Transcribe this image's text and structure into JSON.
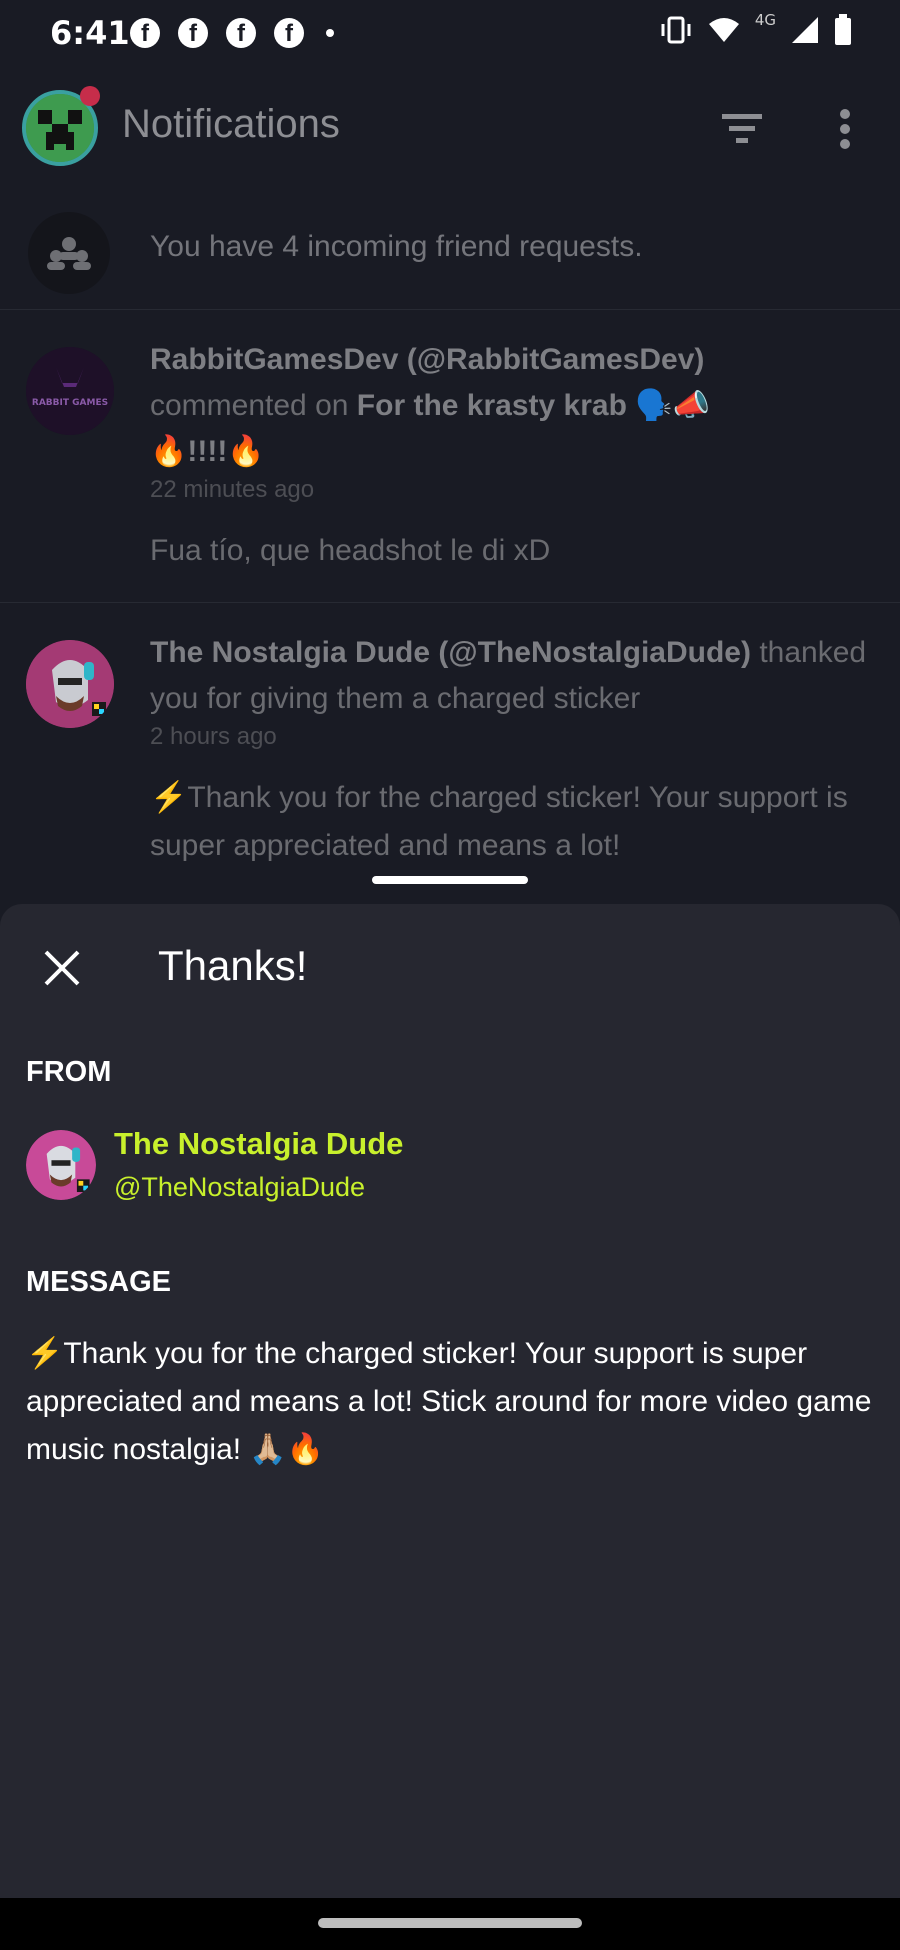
{
  "status_bar": {
    "time": "6:41",
    "network_label": "4G",
    "icons": [
      "facebook-icon",
      "facebook-icon",
      "facebook-icon",
      "facebook-icon",
      "dot-icon",
      "vibrate-icon",
      "wifi-icon",
      "signal-icon",
      "battery-icon"
    ]
  },
  "app_bar": {
    "title": "Notifications"
  },
  "friend_requests": {
    "text": "You have 4 incoming friend requests."
  },
  "notifications": [
    {
      "user": "RabbitGamesDev (@RabbitGamesDev)",
      "action": "commented on",
      "target": "For the krasty krab",
      "emoji_line": "🗣️📣",
      "target_line2": "🔥!!!!🔥",
      "time": "22 minutes ago",
      "quote": "Fua tío, que headshot le di xD",
      "avatar_text": "RABBIT GAMES"
    },
    {
      "user": "The Nostalgia Dude (@TheNostalgiaDude)",
      "action": "thanked you for giving them a charged sticker",
      "time": "2 hours ago",
      "quote": "⚡Thank you for the charged sticker! Your support is super appreciated and means a lot!"
    }
  ],
  "sheet": {
    "title": "Thanks!",
    "from_label": "FROM",
    "from_name": "The Nostalgia Dude",
    "from_handle": "@TheNostalgiaDude",
    "message_label": "MESSAGE",
    "message": "⚡Thank you for the charged sticker! Your support is super appreciated and means a lot! Stick around for more video game music nostalgia! 🙏🏼🔥"
  },
  "colors": {
    "accent": "#c8f02c",
    "sheet_bg": "#262730",
    "page_bg": "#191b24"
  }
}
